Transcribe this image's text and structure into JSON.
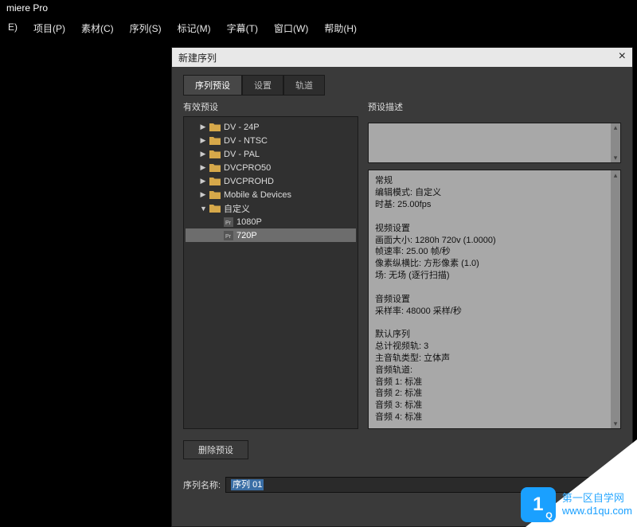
{
  "app": {
    "title": "miere Pro"
  },
  "menubar": [
    "E)",
    "项目(P)",
    "素材(C)",
    "序列(S)",
    "标记(M)",
    "字幕(T)",
    "窗口(W)",
    "帮助(H)"
  ],
  "dialog": {
    "title": "新建序列",
    "tabs": [
      "序列预设",
      "设置",
      "轨道"
    ],
    "activeTab": 0,
    "leftLabel": "有效预设",
    "rightLabel": "预设描述",
    "tree": [
      {
        "type": "folder",
        "label": "DV - 24P",
        "expand": "▶",
        "depth": 1
      },
      {
        "type": "folder",
        "label": "DV - NTSC",
        "expand": "▶",
        "depth": 1
      },
      {
        "type": "folder",
        "label": "DV - PAL",
        "expand": "▶",
        "depth": 1
      },
      {
        "type": "folder",
        "label": "DVCPRO50",
        "expand": "▶",
        "depth": 1
      },
      {
        "type": "folder",
        "label": "DVCPROHD",
        "expand": "▶",
        "depth": 1
      },
      {
        "type": "folder",
        "label": "Mobile & Devices",
        "expand": "▶",
        "depth": 1
      },
      {
        "type": "folder",
        "label": "自定义",
        "expand": "▼",
        "depth": 1
      },
      {
        "type": "file",
        "label": "1080P",
        "depth": 2
      },
      {
        "type": "file",
        "label": "720P",
        "depth": 2,
        "selected": true
      }
    ],
    "details": "常规\n编辑模式: 自定义\n时基: 25.00fps\n\n视频设置\n画面大小: 1280h 720v (1.0000)\n帧速率: 25.00 帧/秒\n像素纵横比: 方形像素 (1.0)\n场: 无场 (逐行扫描)\n\n音频设置\n采样率: 48000 采样/秒\n\n默认序列\n总计视频轨: 3\n主音轨类型: 立体声\n音频轨道:\n音频 1: 标准\n音频 2: 标准\n音频 3: 标准\n音频 4: 标准",
    "deleteBtn": "删除预设",
    "nameLabel": "序列名称:",
    "nameValue": "序列 01",
    "okBtn": "",
    "cancelBtn": ""
  },
  "watermark": {
    "badge": "1",
    "badgeSub": "Q",
    "line1": "第一区自学网",
    "line2": "www.d1qu.com"
  }
}
